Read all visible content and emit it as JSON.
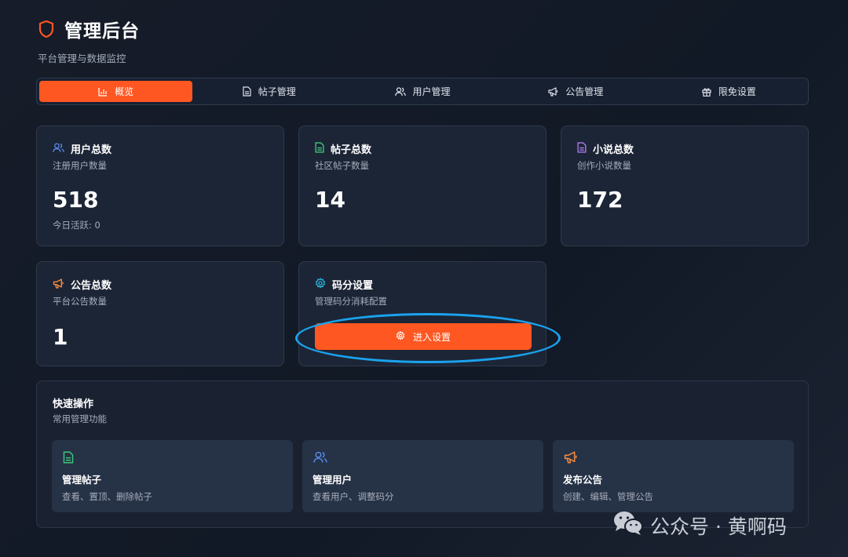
{
  "header": {
    "title": "管理后台",
    "subtitle": "平台管理与数据监控"
  },
  "tabs": [
    {
      "label": "概览",
      "icon": "bar-chart-icon",
      "active": true
    },
    {
      "label": "帖子管理",
      "icon": "document-icon"
    },
    {
      "label": "用户管理",
      "icon": "users-icon"
    },
    {
      "label": "公告管理",
      "icon": "megaphone-icon"
    },
    {
      "label": "限免设置",
      "icon": "gift-icon"
    }
  ],
  "stats": {
    "users": {
      "title": "用户总数",
      "subtitle": "注册用户数量",
      "value": "518",
      "extra": "今日活跃: 0",
      "icon": "users-icon",
      "color": "#5b8def"
    },
    "posts": {
      "title": "帖子总数",
      "subtitle": "社区帖子数量",
      "value": "14",
      "icon": "document-icon",
      "color": "#3ec47a"
    },
    "novels": {
      "title": "小说总数",
      "subtitle": "创作小说数量",
      "value": "172",
      "icon": "document-icon",
      "color": "#a97ae8"
    },
    "announcements": {
      "title": "公告总数",
      "subtitle": "平台公告数量",
      "value": "1",
      "icon": "megaphone-icon",
      "color": "#f0883e"
    },
    "code_points": {
      "title": "码分设置",
      "subtitle": "管理码分消耗配置",
      "button": "进入设置",
      "icon": "gear-icon",
      "color": "#27b3d9"
    }
  },
  "quick": {
    "title": "快速操作",
    "subtitle": "常用管理功能",
    "items": [
      {
        "title": "管理帖子",
        "desc": "查看、置顶、删除帖子",
        "icon": "document-icon",
        "color": "#3ec47a"
      },
      {
        "title": "管理用户",
        "desc": "查看用户、调整码分",
        "icon": "users-icon",
        "color": "#5b8def"
      },
      {
        "title": "发布公告",
        "desc": "创建、编辑、管理公告",
        "icon": "megaphone-icon",
        "color": "#f0883e"
      }
    ]
  },
  "colors": {
    "accent": "#ff5722",
    "highlight": "#1aa3ee"
  },
  "watermark": {
    "text": "公众号 · 黄啊码",
    "icon": "wechat-icon"
  }
}
